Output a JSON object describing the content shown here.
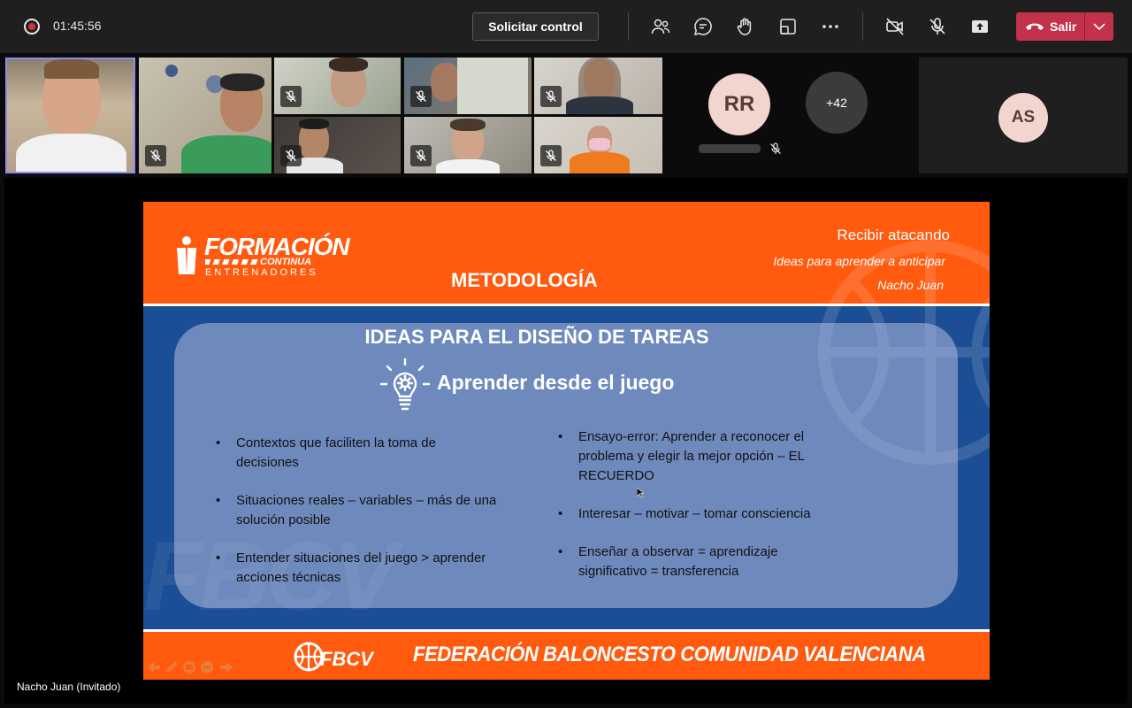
{
  "toolbar": {
    "timer": "01:45:56",
    "request_control": "Solicitar control",
    "leave": "Salir",
    "accent_leave": "#c4314b"
  },
  "participants": {
    "avatar_rr": "RR",
    "avatar_rr_bg": "#f3d5cf",
    "overflow_count": "+42",
    "avatar_as": "AS"
  },
  "slide": {
    "header_right_1": "Recibir atacando",
    "header_right_2": "Ideas para aprender a anticipar",
    "header_right_3": "Nacho Juan",
    "title": "METODOLOGÍA",
    "logo": {
      "line1": "FORMACIÓN",
      "line2": "CONTINUA",
      "line3": "ENTRENADORES"
    },
    "panel_title": "IDEAS PARA EL DISEÑO DE TAREAS",
    "panel_subtitle": "Aprender desde el juego",
    "bullets_left": [
      {
        "line1": "Contextos que faciliten la toma de",
        "line2": "decisiones"
      },
      {
        "line1": "Situaciones reales – variables – más de una",
        "line2": "solución posible"
      },
      {
        "line1": "Entender situaciones del juego > aprender",
        "line2": "acciones técnicas"
      }
    ],
    "bullets_right": [
      {
        "line1": "Ensayo-error: Aprender a reconocer el",
        "line2": "problema y elegir la mejor opción – EL",
        "line3": "RECUERDO"
      },
      {
        "line1": "Interesar – motivar – tomar consciencia"
      },
      {
        "line1": "Enseñar a observar = aprendizaje",
        "line2": "significativo = transferencia"
      }
    ],
    "watermark": "FBCV",
    "footer_logo": "FBCV",
    "footer_text": "FEDERACIÓN BALONCESTO COMUNIDAD VALENCIANA"
  },
  "presenter_label": "Nacho Juan (Invitado)"
}
